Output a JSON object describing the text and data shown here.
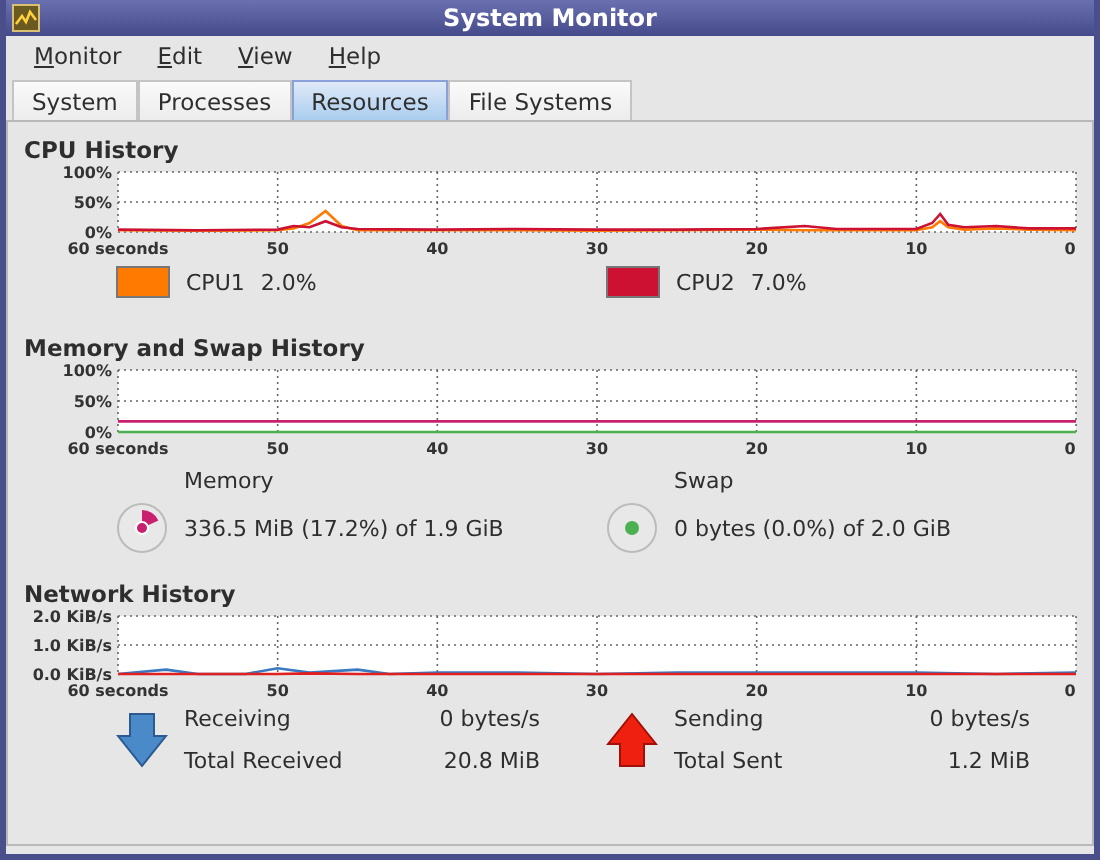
{
  "window": {
    "title": "System Monitor"
  },
  "menu": [
    "Monitor",
    "Edit",
    "View",
    "Help"
  ],
  "tabs": [
    {
      "label": "System",
      "selected": false
    },
    {
      "label": "Processes",
      "selected": false
    },
    {
      "label": "Resources",
      "selected": true
    },
    {
      "label": "File Systems",
      "selected": false
    }
  ],
  "cpu": {
    "title": "CPU History",
    "chart_data": {
      "type": "line",
      "grid": true,
      "x": [
        60,
        55,
        50,
        49,
        48,
        47,
        46,
        45,
        40,
        35,
        30,
        25,
        20,
        17,
        15,
        10,
        9,
        8.5,
        8,
        7,
        5,
        3,
        0
      ],
      "xlim": [
        60,
        0
      ],
      "ylim": [
        0,
        100
      ],
      "xticks": [
        {
          "value": 60,
          "label": "60 seconds"
        },
        50,
        40,
        30,
        20,
        10,
        0
      ],
      "yticks": [
        {
          "value": 0,
          "label": "0%"
        },
        {
          "value": 50,
          "label": "50%"
        },
        {
          "value": 100,
          "label": "100%"
        }
      ],
      "series": [
        {
          "name": "CPU1",
          "color": "#ff7a00",
          "values": [
            3,
            2,
            3,
            6,
            15,
            35,
            10,
            3,
            3,
            3,
            2,
            3,
            4,
            3,
            3,
            3,
            8,
            18,
            8,
            4,
            6,
            4,
            3
          ]
        },
        {
          "name": "CPU2",
          "color": "#cc1133",
          "values": [
            4,
            3,
            4,
            10,
            8,
            18,
            8,
            5,
            4,
            5,
            4,
            4,
            5,
            10,
            5,
            5,
            15,
            30,
            12,
            8,
            10,
            6,
            6
          ]
        }
      ]
    },
    "legend": [
      {
        "value": "2.0%"
      },
      {
        "value": "7.0%"
      }
    ]
  },
  "memory": {
    "title": "Memory and Swap History",
    "chart_data": {
      "type": "line",
      "grid": true,
      "x": [
        60,
        0
      ],
      "xlim": [
        60,
        0
      ],
      "ylim": [
        0,
        100
      ],
      "xticks": [
        {
          "value": 60,
          "label": "60 seconds"
        },
        50,
        40,
        30,
        20,
        10,
        0
      ],
      "yticks": [
        {
          "value": 0,
          "label": "0%"
        },
        {
          "value": 50,
          "label": "50%"
        },
        {
          "value": 100,
          "label": "100%"
        }
      ],
      "series": [
        {
          "name": "Memory",
          "color": "#c8206e",
          "values": [
            17,
            17
          ]
        },
        {
          "name": "Swap",
          "color": "#4caf50",
          "values": [
            0,
            0
          ]
        }
      ]
    },
    "legend": [
      {
        "kind": "memory",
        "value": "336.5 MiB (17.2%) of 1.9 GiB"
      },
      {
        "kind": "swap",
        "value": "0 bytes (0.0%) of 2.0 GiB"
      }
    ]
  },
  "network": {
    "title": "Network History",
    "chart_data": {
      "type": "line",
      "grid": true,
      "x": [
        60,
        57,
        55,
        52,
        50,
        48,
        45,
        43,
        40,
        35,
        30,
        25,
        20,
        15,
        10,
        5,
        0
      ],
      "xlim": [
        60,
        0
      ],
      "ylim": [
        0,
        2
      ],
      "xticks": [
        {
          "value": 60,
          "label": "60 seconds"
        },
        50,
        40,
        30,
        20,
        10,
        0
      ],
      "yticks": [
        {
          "value": 0,
          "label": "0.0 KiB/s"
        },
        {
          "value": 1,
          "label": "1.0 KiB/s"
        },
        {
          "value": 2,
          "label": "2.0 KiB/s"
        }
      ],
      "series": [
        {
          "name": "Receiving",
          "color": "#3a78c0",
          "values": [
            0,
            0.15,
            0,
            0,
            0.2,
            0.05,
            0.15,
            0,
            0.05,
            0.05,
            0,
            0.05,
            0.05,
            0.05,
            0.05,
            0,
            0.05
          ]
        },
        {
          "name": "Sending",
          "color": "#e02020",
          "values": [
            0,
            0,
            0,
            0,
            0,
            0.02,
            0,
            0,
            0,
            0,
            0,
            0,
            0,
            0,
            0,
            0,
            0
          ]
        }
      ]
    },
    "legend": [
      {
        "kind": "receive",
        "rate": "0 bytes/s",
        "total_label": "Total Received",
        "total": "20.8 MiB"
      },
      {
        "kind": "send",
        "rate": "0 bytes/s",
        "total_label": "Total Sent",
        "total": "1.2 MiB"
      }
    ]
  }
}
